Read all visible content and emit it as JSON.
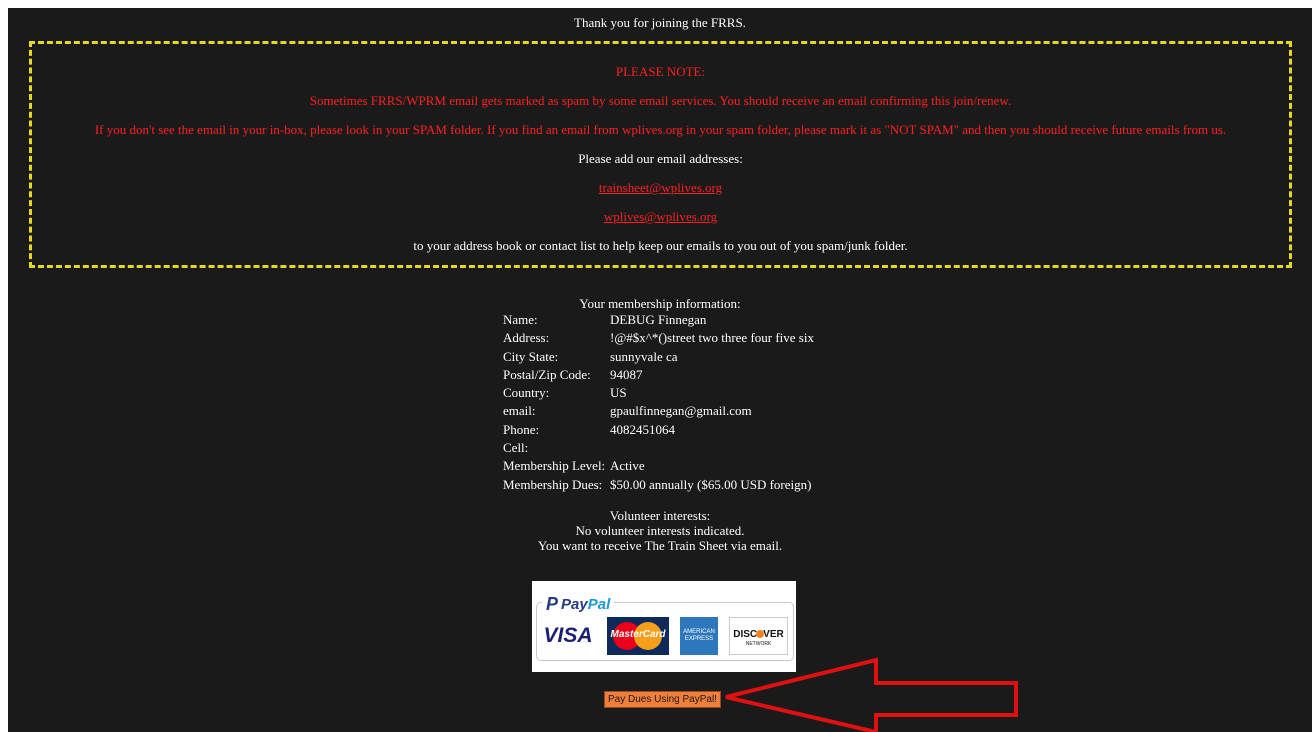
{
  "header": {
    "thanks": "Thank you for joining the FRRS."
  },
  "notice": {
    "please_note": "PLEASE NOTE:",
    "spam_warning": "Sometimes FRRS/WPRM email gets marked as spam by some email services. You should receive an email confirming this join/renew.",
    "spam_instructions": "If you don't see the email in your in-box, please look in your SPAM folder. If you find an email from wplives.org in your spam folder, please mark it as \"NOT SPAM\" and then you should receive future emails from us.",
    "add_addresses": "Please add our email addresses:",
    "email1": "trainsheet@wplives.org",
    "email2": "wplives@wplives.org",
    "address_book": "to your address book or contact list to help keep our emails to you out of you spam/junk folder."
  },
  "membership": {
    "title": "Your membership information:",
    "rows": [
      {
        "label": "Name:",
        "value": "DEBUG Finnegan"
      },
      {
        "label": "Address:",
        "value": "!@#$x^*()street two three four five six"
      },
      {
        "label": "City State:",
        "value": "sunnyvale ca"
      },
      {
        "label": "Postal/Zip Code:",
        "value": "94087"
      },
      {
        "label": "Country:",
        "value": "US"
      },
      {
        "label": "email:",
        "value": "gpaulfinnegan@gmail.com"
      },
      {
        "label": "Phone:",
        "value": "4082451064"
      },
      {
        "label": "Cell:",
        "value": ""
      },
      {
        "label": "Membership Level:",
        "value": "Active"
      },
      {
        "label": "Membership Dues:",
        "value": "$50.00 annually ($65.00 USD foreign)"
      }
    ]
  },
  "volunteer": {
    "title": "Volunteer interests:",
    "none": "No volunteer interests indicated.",
    "trainsheet": "You want to receive The Train Sheet via email."
  },
  "paypal": {
    "logo_pay": "Pay",
    "logo_pal": "Pal",
    "visa": "VISA",
    "mastercard": "MasterCard",
    "amex": "AMERICAN EXPRESS",
    "discover": "DISC",
    "discover_end": "VER",
    "discover_network": "NETWORK",
    "button_label": "Pay Dues Using PayPal!"
  },
  "colors": {
    "background": "#1a1a1a",
    "notice_red": "#ff2020",
    "border_yellow": "#e6d81f",
    "button": "#f07f3c",
    "arrow": "#e01010"
  }
}
